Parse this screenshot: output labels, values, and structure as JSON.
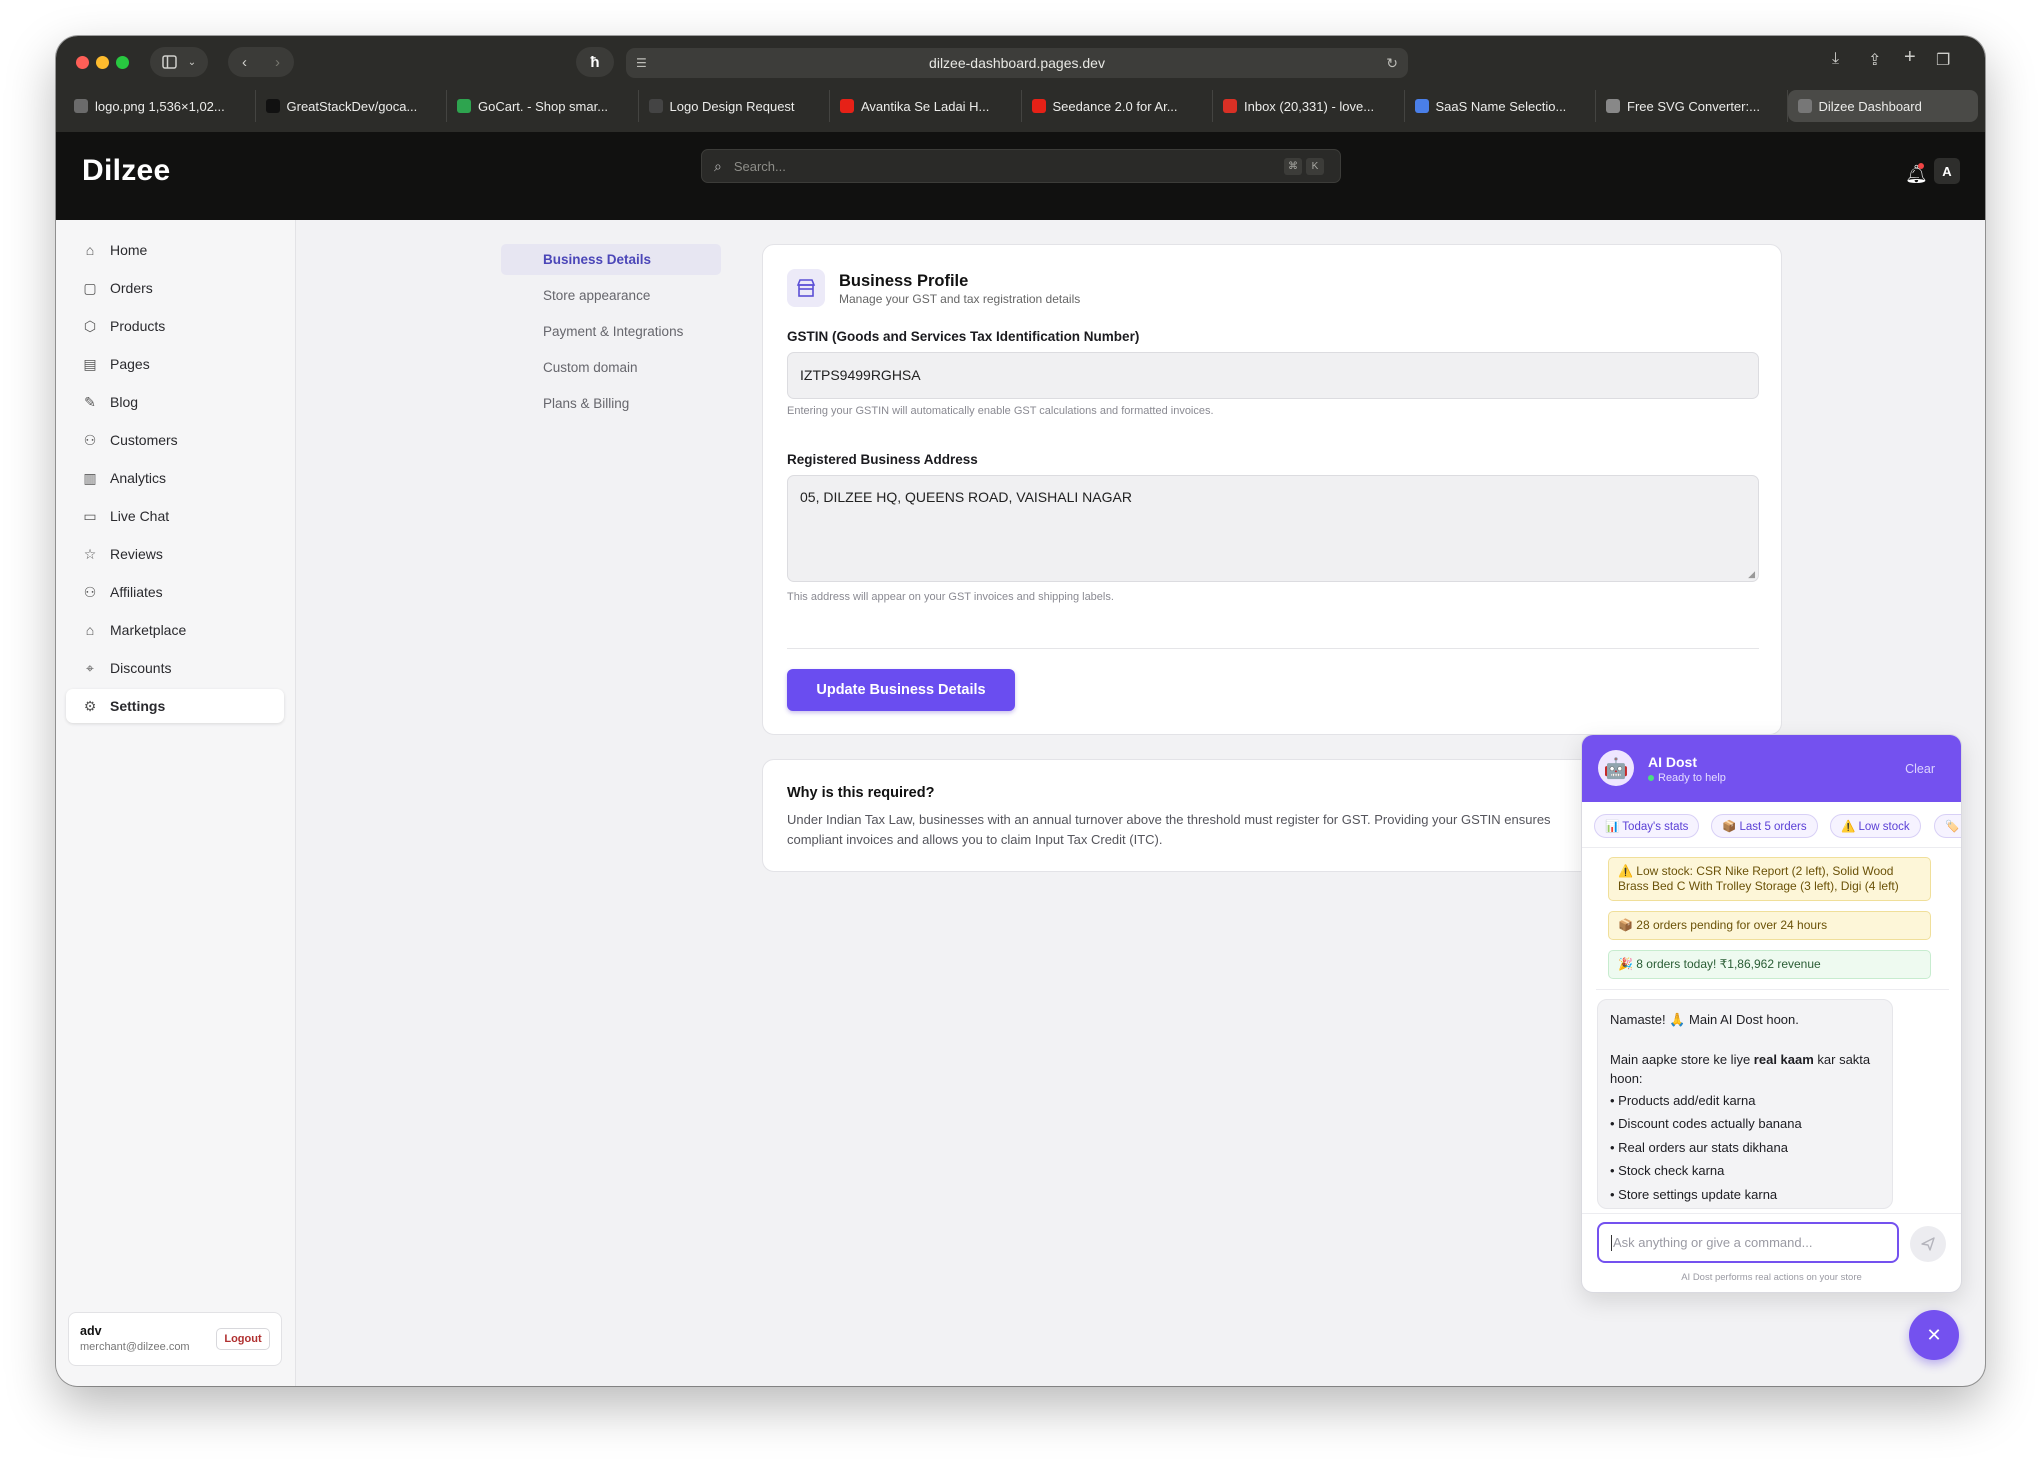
{
  "browser": {
    "url": "dilzee-dashboard.pages.dev",
    "tabs": [
      {
        "label": "logo.png 1,536×1,02...",
        "icon": "image-icon",
        "color": "#6b6b6b"
      },
      {
        "label": "GreatStackDev/goca...",
        "icon": "github-icon",
        "color": "#111111"
      },
      {
        "label": "GoCart. - Shop smar...",
        "icon": "gocart-icon",
        "color": "#2ea44f"
      },
      {
        "label": "Logo Design Request",
        "icon": "chatgpt-icon",
        "color": "#444444"
      },
      {
        "label": "Avantika Se Ladai H...",
        "icon": "youtube-icon",
        "color": "#e62117"
      },
      {
        "label": "Seedance 2.0 for Ar...",
        "icon": "youtube-icon",
        "color": "#e62117"
      },
      {
        "label": "Inbox (20,331) - love...",
        "icon": "gmail-icon",
        "color": "#d93025"
      },
      {
        "label": "SaaS Name Selectio...",
        "icon": "gemini-icon",
        "color": "#4a7fe8"
      },
      {
        "label": "Free SVG Converter:...",
        "icon": "svg-converter-icon",
        "color": "#888888"
      },
      {
        "label": "Dilzee Dashboard",
        "icon": "dilzee-icon",
        "color": "#777777"
      }
    ]
  },
  "app": {
    "logo": "Dilzee",
    "search_placeholder": "Search...",
    "shortcut_keys": [
      "⌘",
      "K"
    ],
    "avatar_initial": "A"
  },
  "sidebar": {
    "items": [
      {
        "label": "Home",
        "icon": "home-icon"
      },
      {
        "label": "Orders",
        "icon": "orders-icon"
      },
      {
        "label": "Products",
        "icon": "products-icon"
      },
      {
        "label": "Pages",
        "icon": "pages-icon"
      },
      {
        "label": "Blog",
        "icon": "blog-icon"
      },
      {
        "label": "Customers",
        "icon": "customers-icon"
      },
      {
        "label": "Analytics",
        "icon": "analytics-icon"
      },
      {
        "label": "Live Chat",
        "icon": "chat-icon"
      },
      {
        "label": "Reviews",
        "icon": "star-icon"
      },
      {
        "label": "Affiliates",
        "icon": "affiliates-icon"
      },
      {
        "label": "Marketplace",
        "icon": "marketplace-icon"
      },
      {
        "label": "Discounts",
        "icon": "discount-icon"
      },
      {
        "label": "Settings",
        "icon": "settings-icon",
        "active": true
      }
    ],
    "user": {
      "name": "adv",
      "email": "merchant@dilzee.com",
      "logout": "Logout"
    }
  },
  "settings_nav": {
    "items": [
      "Business Details",
      "Store appearance",
      "Payment & Integrations",
      "Custom domain",
      "Plans & Billing"
    ],
    "active": "Business Details"
  },
  "business_profile": {
    "title": "Business Profile",
    "subtitle": "Manage your GST and tax registration details",
    "gstin_label": "GSTIN (Goods and Services Tax Identification Number)",
    "gstin_value": "IZTPS9499RGHSA",
    "gstin_hint": "Entering your GSTIN will automatically enable GST calculations and formatted invoices.",
    "address_label": "Registered Business Address",
    "address_value": "05, DILZEE HQ, QUEENS ROAD, VAISHALI NAGAR",
    "address_hint": "This address will appear on your GST invoices and shipping labels.",
    "submit": "Update Business Details"
  },
  "info_card": {
    "title": "Why is this required?",
    "line1": "Under Indian Tax Law, businesses with an annual turnover above the threshold must register for GST. Providing your GSTIN ensures",
    "line2": "compliant invoices and allows you to claim Input Tax Credit (ITC)."
  },
  "ai_chat": {
    "name": "AI Dost",
    "status": "Ready to help",
    "clear": "Clear",
    "chips": [
      "📊 Today's stats",
      "📦 Last 5 orders",
      "⚠️ Low stock"
    ],
    "alerts": [
      {
        "text": "⚠️ Low stock: CSR Nike Report (2 left), Solid Wood Brass Bed C With Trolley Storage (3 left), Digi (4 left)",
        "kind": "warning"
      },
      {
        "text": "📦 28 orders pending for over 24 hours",
        "kind": "warning"
      },
      {
        "text": "🎉 8 orders today! ₹1,86,962 revenue",
        "kind": "success"
      }
    ],
    "message": {
      "greeting": "Namaste! 🙏 Main AI Dost hoon.",
      "intro_prefix": "Main aapke store ke liye ",
      "intro_bold": "real kaam",
      "intro_suffix": " kar sakta hoon:",
      "bullets": [
        "• Products add/edit karna",
        "• Discount codes actually banana",
        "• Real orders aur stats dikhana",
        "• Stock check karna",
        "• Store settings update karna"
      ]
    },
    "input_placeholder": "Ask anything or give a command...",
    "footer": "AI Dost performs real actions on your store"
  },
  "colors": {
    "accent": "#6a4df0",
    "chat_header": "#7451ef",
    "app_bar": "#111110"
  }
}
